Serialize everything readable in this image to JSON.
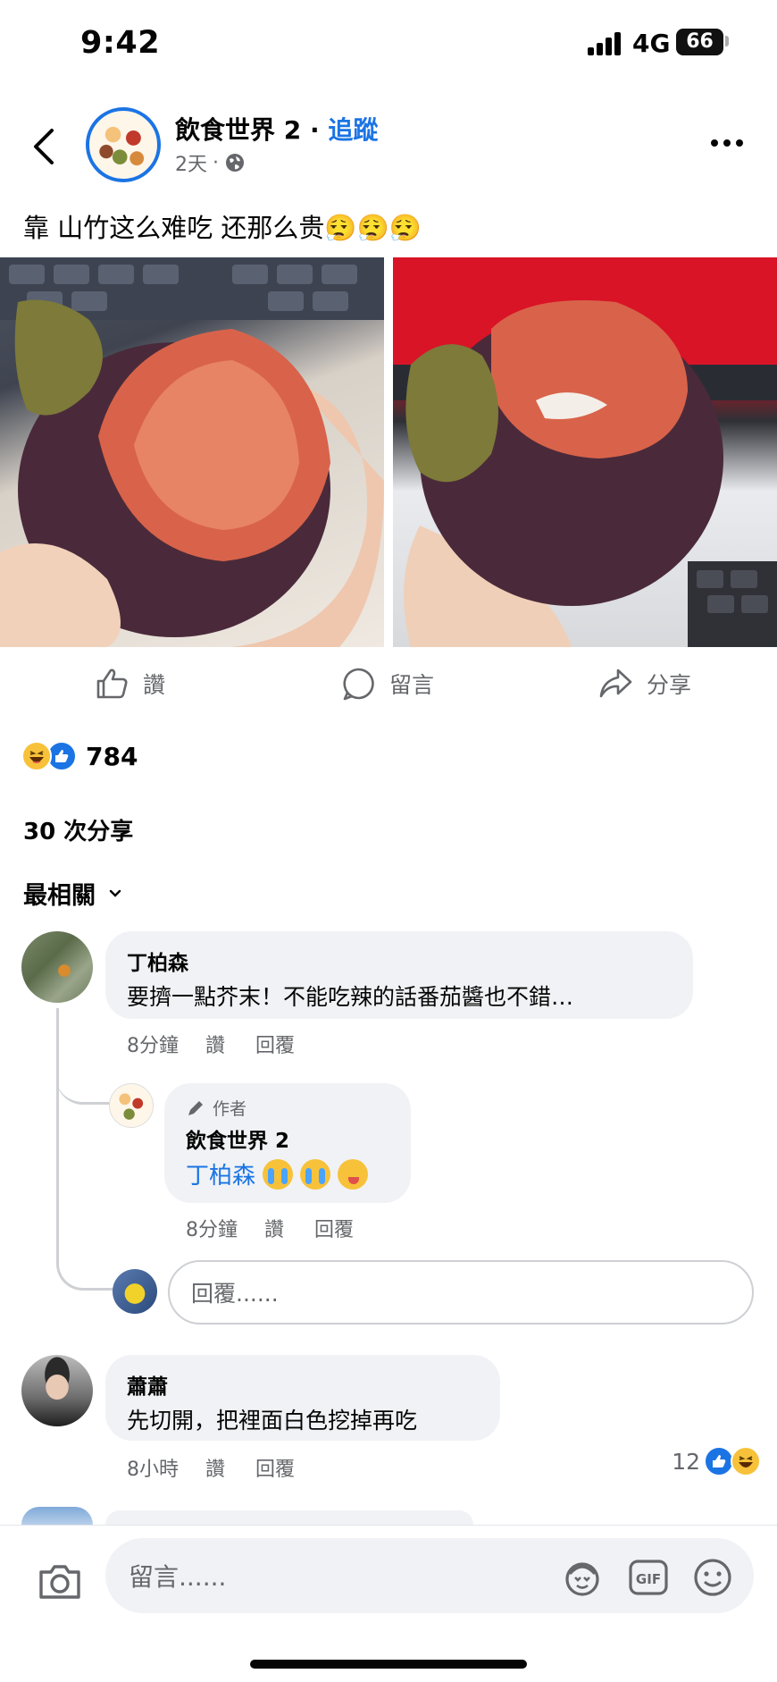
{
  "status_bar": {
    "time": "9:42",
    "network": "4G",
    "battery": "66"
  },
  "header": {
    "page_name": "飲食世界 2",
    "separator": " · ",
    "follow_label": "追蹤",
    "time_ago": "2天",
    "dot": "·"
  },
  "post": {
    "text": "靠 山竹这么难吃 还那么贵😮‍💨😮‍💨😮‍💨"
  },
  "actions": {
    "like_label": "讚",
    "comment_label": "留言",
    "share_label": "分享"
  },
  "reactions": {
    "count": "784"
  },
  "shares": {
    "label": "30 次分享"
  },
  "sort": {
    "label": "最相關"
  },
  "comments": [
    {
      "name": "丁柏森",
      "text": "要擠一點芥末！不能吃辣的話番茄醬也不錯…",
      "time": "8分鐘",
      "like": "讚",
      "reply": "回覆"
    },
    {
      "author_tag": "作者",
      "name": "飲食世界 2",
      "mention": "丁柏森",
      "time": "8分鐘",
      "like": "讚",
      "reply": "回覆"
    },
    {
      "name": "蕭蕭",
      "text": "先切開，把裡面白色挖掉再吃",
      "time": "8小時",
      "like": "讚",
      "reply": "回覆",
      "like_count": "12"
    }
  ],
  "reply_box": {
    "placeholder": "回覆......"
  },
  "composer": {
    "placeholder": "留言......",
    "gif_label": "GIF"
  },
  "colors": {
    "accent": "#1b74e4",
    "bubble": "#f0f2f5",
    "secondary_text": "#65676b"
  }
}
